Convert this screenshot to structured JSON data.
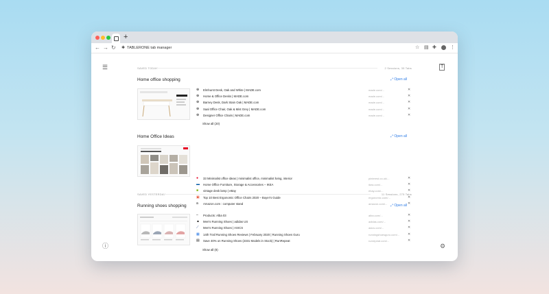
{
  "browser": {
    "new_tab_label": "+",
    "url_text": "TABLERONE tab manager",
    "nav": {
      "back": "←",
      "forward": "→",
      "reload": "↻"
    }
  },
  "sidebar": {
    "list_icon": "list-icon",
    "help_icon": "help-icon"
  },
  "right_rail": {
    "translate_icon": "translate-icon",
    "settings_icon": "gear-icon"
  },
  "sections": [
    {
      "label": "SAVED TODAY",
      "count": "2 Sessions, 35 Tabs",
      "groups": [
        {
          "title": "Home office shopping",
          "open_all": "Open all",
          "show_all": "Show all (20)",
          "tabs": [
            {
              "title": "Elmhurst Desk, Oak and White | MADE.com",
              "domain": "made.com/..."
            },
            {
              "title": "Home & Office Desks | MADE.com",
              "domain": "made.com/..."
            },
            {
              "title": "Barney Desk, Dark Stain Oak | MADE.com",
              "domain": "made.com/..."
            },
            {
              "title": "Saal Office Chair, Oak & Mist Grey | MADE.com",
              "domain": "made.com/..."
            },
            {
              "title": "Designer Office Chairs | MADE.com",
              "domain": "made.com/..."
            }
          ]
        },
        {
          "title": "Home Office Ideas",
          "open_all": "Open all",
          "tabs": [
            {
              "title": "33 Minimalist office ideas | minimalist office, minimalist living, interior",
              "domain": "pinterest.co.uk/..."
            },
            {
              "title": "Home Office Furniture, Storage & Accessories – IKEA",
              "domain": "ikea.com/..."
            },
            {
              "title": "vintage desk lamp | eBay",
              "domain": "ebay.com/..."
            },
            {
              "title": "Top 10 Best Ergonomic Office Chairs 2020 – Buyer's Guide",
              "domain": "ergonomic.com/..."
            },
            {
              "title": "Amazon.com : computer stand",
              "domain": "amazon.com/..."
            }
          ]
        }
      ]
    },
    {
      "label": "SAVED YESTERDAY",
      "count": "11 Sessions, 275 Tabs",
      "groups": [
        {
          "title": "Running shoes shopping",
          "open_all": "Open all",
          "show_all": "Show all (8)",
          "tabs": [
            {
              "title": "Products: Alba 03",
              "domain": "alba.com/..."
            },
            {
              "title": "Men's Running Shoes | adidas US",
              "domain": "adidas.com/..."
            },
            {
              "title": "Men's Running Shoes | ASICS",
              "domain": "asics.com/..."
            },
            {
              "title": "14th Trail Running Shoes Reviews | February 2020 | Running Shoes Guru",
              "domain": "runningshoesguru.com/..."
            },
            {
              "title": "Save 40% on Running Shoes (2331 Models in Stock) | RunRepeat",
              "domain": "runrepeat.com/..."
            }
          ]
        }
      ]
    }
  ],
  "colors": {
    "accent": "#2d7be5",
    "background_top": "#a9dcf2",
    "background_bottom": "#f2e3e0"
  }
}
